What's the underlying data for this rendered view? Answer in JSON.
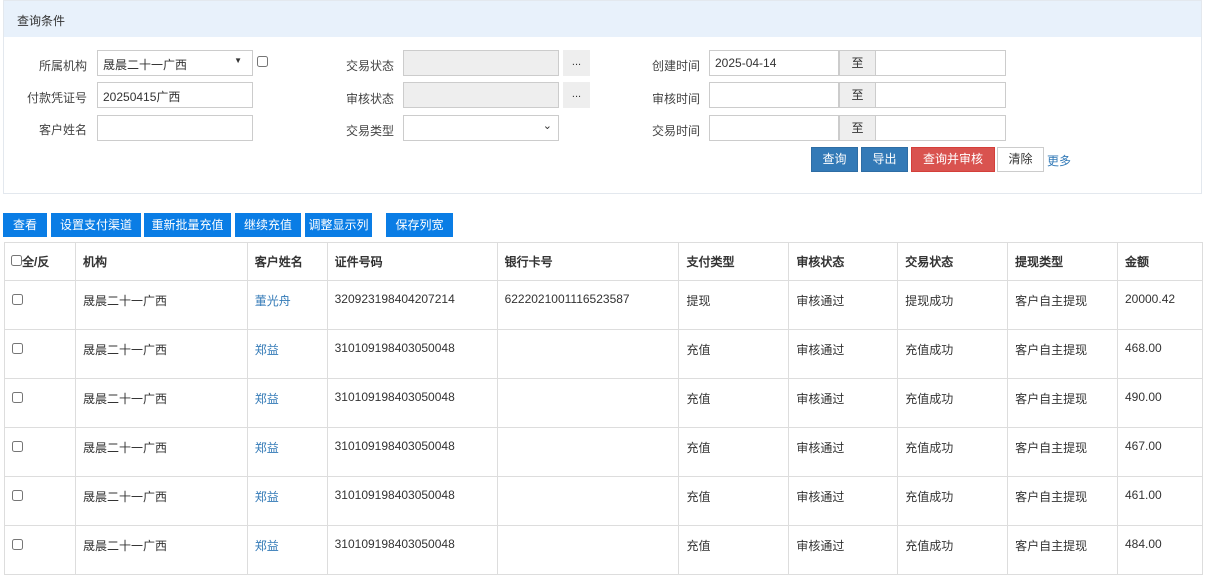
{
  "panel": {
    "title": "查询条件"
  },
  "form": {
    "org_label": "所属机构",
    "org_value": "晟晨二十一广西",
    "voucher_label": "付款凭证号",
    "voucher_value": "20250415广西",
    "customer_label": "客户姓名",
    "customer_value": "",
    "trade_status_label": "交易状态",
    "audit_status_label": "审核状态",
    "trade_type_label": "交易类型",
    "dots": "...",
    "create_time_label": "创建时间",
    "create_time_from": "2025-04-14",
    "audit_time_label": "审核时间",
    "trade_time_label": "交易时间",
    "to": "至"
  },
  "actions": {
    "query": "查询",
    "export": "导出",
    "query_audit": "查询并审核",
    "clear": "清除",
    "more": "更多"
  },
  "toolbar": [
    "查看",
    "设置支付渠道",
    "重新批量充值",
    "继续充值",
    "调整显示列",
    "保存列宽"
  ],
  "table": {
    "headers": [
      "全/反",
      "机构",
      "客户姓名",
      "证件号码",
      "银行卡号",
      "支付类型",
      "审核状态",
      "交易状态",
      "提现类型",
      "金额"
    ],
    "rows": [
      [
        "晟晨二十一广西",
        "董光舟",
        "320923198404207214",
        "6222021001116523587",
        "提现",
        "审核通过",
        "提现成功",
        "客户自主提现",
        "20000.42"
      ],
      [
        "晟晨二十一广西",
        "郑益",
        "310109198403050048",
        "",
        "充值",
        "审核通过",
        "充值成功",
        "客户自主提现",
        "468.00"
      ],
      [
        "晟晨二十一广西",
        "郑益",
        "310109198403050048",
        "",
        "充值",
        "审核通过",
        "充值成功",
        "客户自主提现",
        "490.00"
      ],
      [
        "晟晨二十一广西",
        "郑益",
        "310109198403050048",
        "",
        "充值",
        "审核通过",
        "充值成功",
        "客户自主提现",
        "467.00"
      ],
      [
        "晟晨二十一广西",
        "郑益",
        "310109198403050048",
        "",
        "充值",
        "审核通过",
        "充值成功",
        "客户自主提现",
        "461.00"
      ],
      [
        "晟晨二十一广西",
        "郑益",
        "310109198403050048",
        "",
        "充值",
        "审核通过",
        "充值成功",
        "客户自主提现",
        "484.00"
      ]
    ]
  }
}
